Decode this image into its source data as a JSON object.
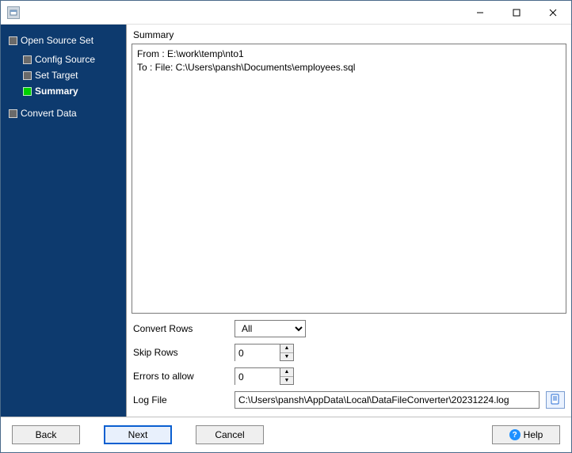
{
  "window": {
    "title": ""
  },
  "sidebar": {
    "root": {
      "label": "Open Source Set",
      "children": [
        {
          "label": "Config Source",
          "current": false
        },
        {
          "label": "Set Target",
          "current": false
        },
        {
          "label": "Summary",
          "current": true
        }
      ]
    },
    "tail": {
      "label": "Convert Data"
    }
  },
  "main": {
    "section_title": "Summary",
    "summary_text": "From : E:\\work\\temp\\nto1\nTo : File: C:\\Users\\pansh\\Documents\\employees.sql"
  },
  "options": {
    "convert_rows": {
      "label": "Convert Rows",
      "value": "All",
      "choices": [
        "All"
      ]
    },
    "skip_rows": {
      "label": "Skip Rows",
      "value": "0"
    },
    "errors_allow": {
      "label": "Errors to allow",
      "value": "0"
    },
    "log_file": {
      "label": "Log File",
      "value": "C:\\Users\\pansh\\AppData\\Local\\DataFileConverter\\20231224.log"
    }
  },
  "footer": {
    "back": "Back",
    "next": "Next",
    "cancel": "Cancel",
    "help": "Help"
  }
}
